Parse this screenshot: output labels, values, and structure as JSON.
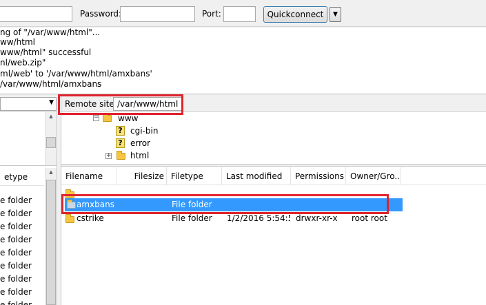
{
  "quickconnect": {
    "password_label": "Password:",
    "port_label": "Port:",
    "button_label": "Quickconnect",
    "dropdown_glyph": "▼"
  },
  "log": {
    "lines": [
      "ng of \"/var/www/html\"...",
      "ww/html",
      "www/html\" successful",
      "nl/web.zip\"",
      "ml/web' to '/var/www/html/amxbans'",
      "/var/www/html/amxbans"
    ]
  },
  "local": {
    "column_filetype": "etype",
    "rows": [
      "e folder",
      "e folder",
      "e folder",
      "e folder",
      "e folder",
      "e folder",
      "e folder",
      "e folder",
      "e folder",
      "e folder"
    ]
  },
  "remote": {
    "site_label": "Remote site:",
    "site_path": "/var/www/html",
    "tree": {
      "www": "www",
      "cgi_bin": "cgi-bin",
      "error": "error",
      "html": "html"
    },
    "columns": {
      "filename": "Filename",
      "filesize": "Filesize",
      "filetype": "Filetype",
      "last_modified": "Last modified",
      "permissions": "Permissions",
      "owner_group": "Owner/Gro..."
    },
    "files": [
      {
        "name": "..",
        "size": "",
        "type": "",
        "modified": "",
        "perms": "",
        "owner": ""
      },
      {
        "name": "amxbans",
        "size": "",
        "type": "File folder",
        "modified": "",
        "perms": "",
        "owner": ""
      },
      {
        "name": "cstrike",
        "size": "",
        "type": "File folder",
        "modified": "1/2/2016 5:54:5...",
        "perms": "drwxr-xr-x",
        "owner": "root root"
      }
    ]
  },
  "colors": {
    "highlight": "#3399ff",
    "annotation": "#e0232d",
    "folder": "#f5c542"
  },
  "icons": {
    "folder": "folder-icon",
    "unknown": "question-icon",
    "expand": "expand-icon",
    "collapse": "collapse-icon"
  }
}
